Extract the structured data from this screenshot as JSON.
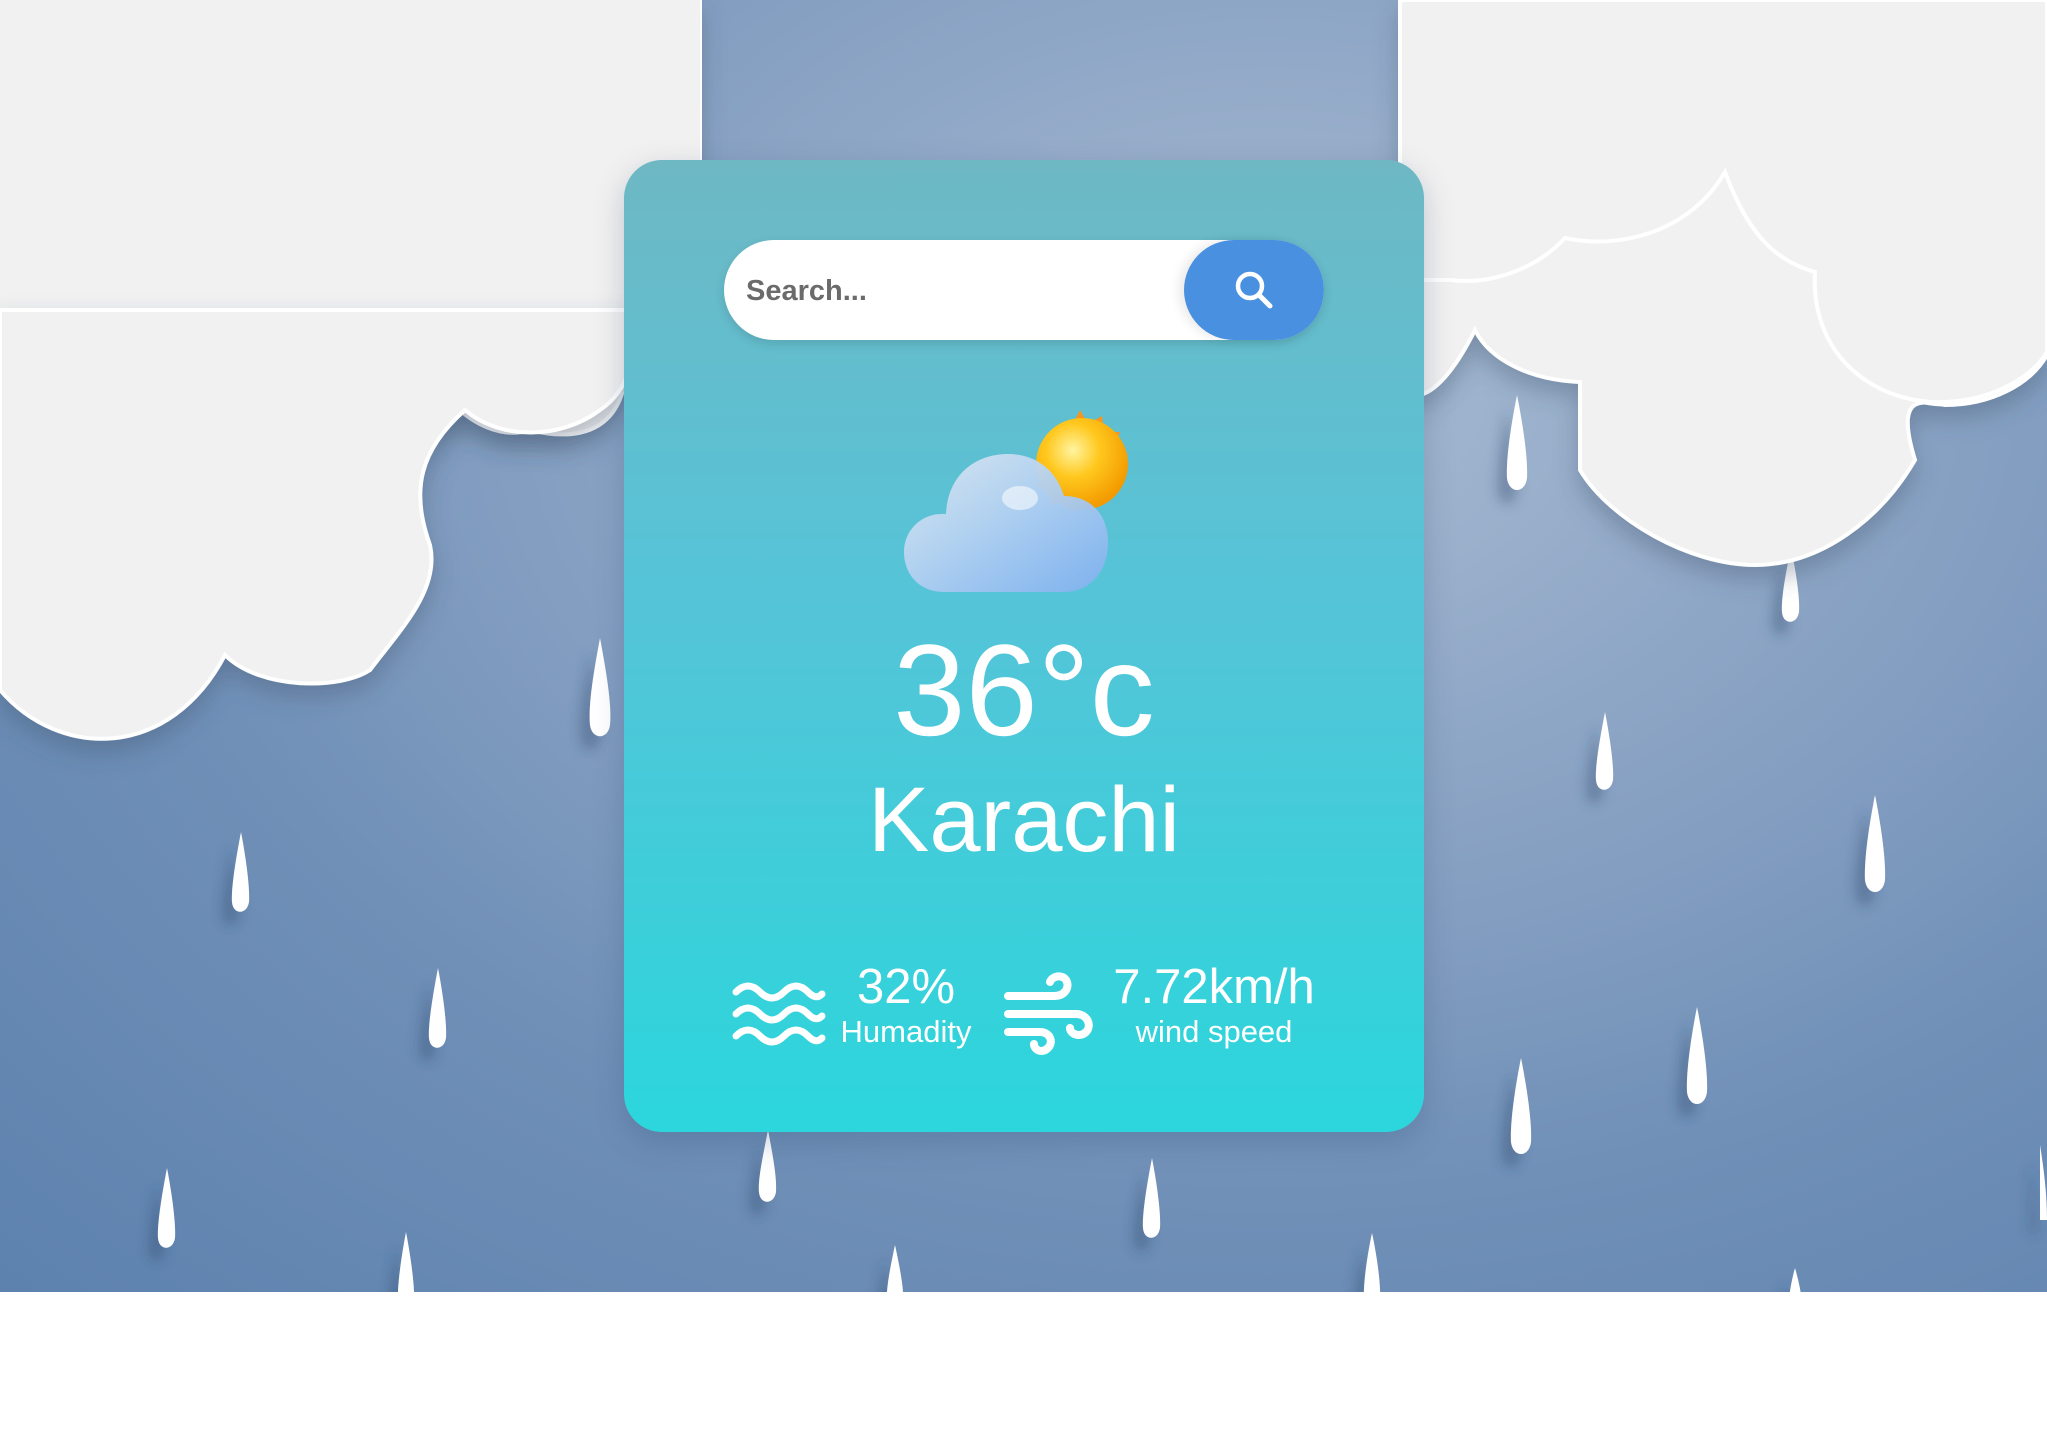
{
  "search": {
    "placeholder": "Search...",
    "button_icon": "search-icon"
  },
  "weather": {
    "icon": "partly-cloudy-icon",
    "temperature": "36°c",
    "city": "Karachi"
  },
  "details": {
    "humidity": {
      "icon": "humidity-waves-icon",
      "value": "32%",
      "label": "Humadity"
    },
    "wind": {
      "icon": "wind-icon",
      "value": "7.72km/h",
      "label": "wind speed"
    }
  },
  "colors": {
    "card_top": "#6eb8c4",
    "card_bottom": "#2bd6dc",
    "search_button": "#4a90e0",
    "background_sky": "#7f9bc0",
    "cloud": "#f2f1f1"
  }
}
